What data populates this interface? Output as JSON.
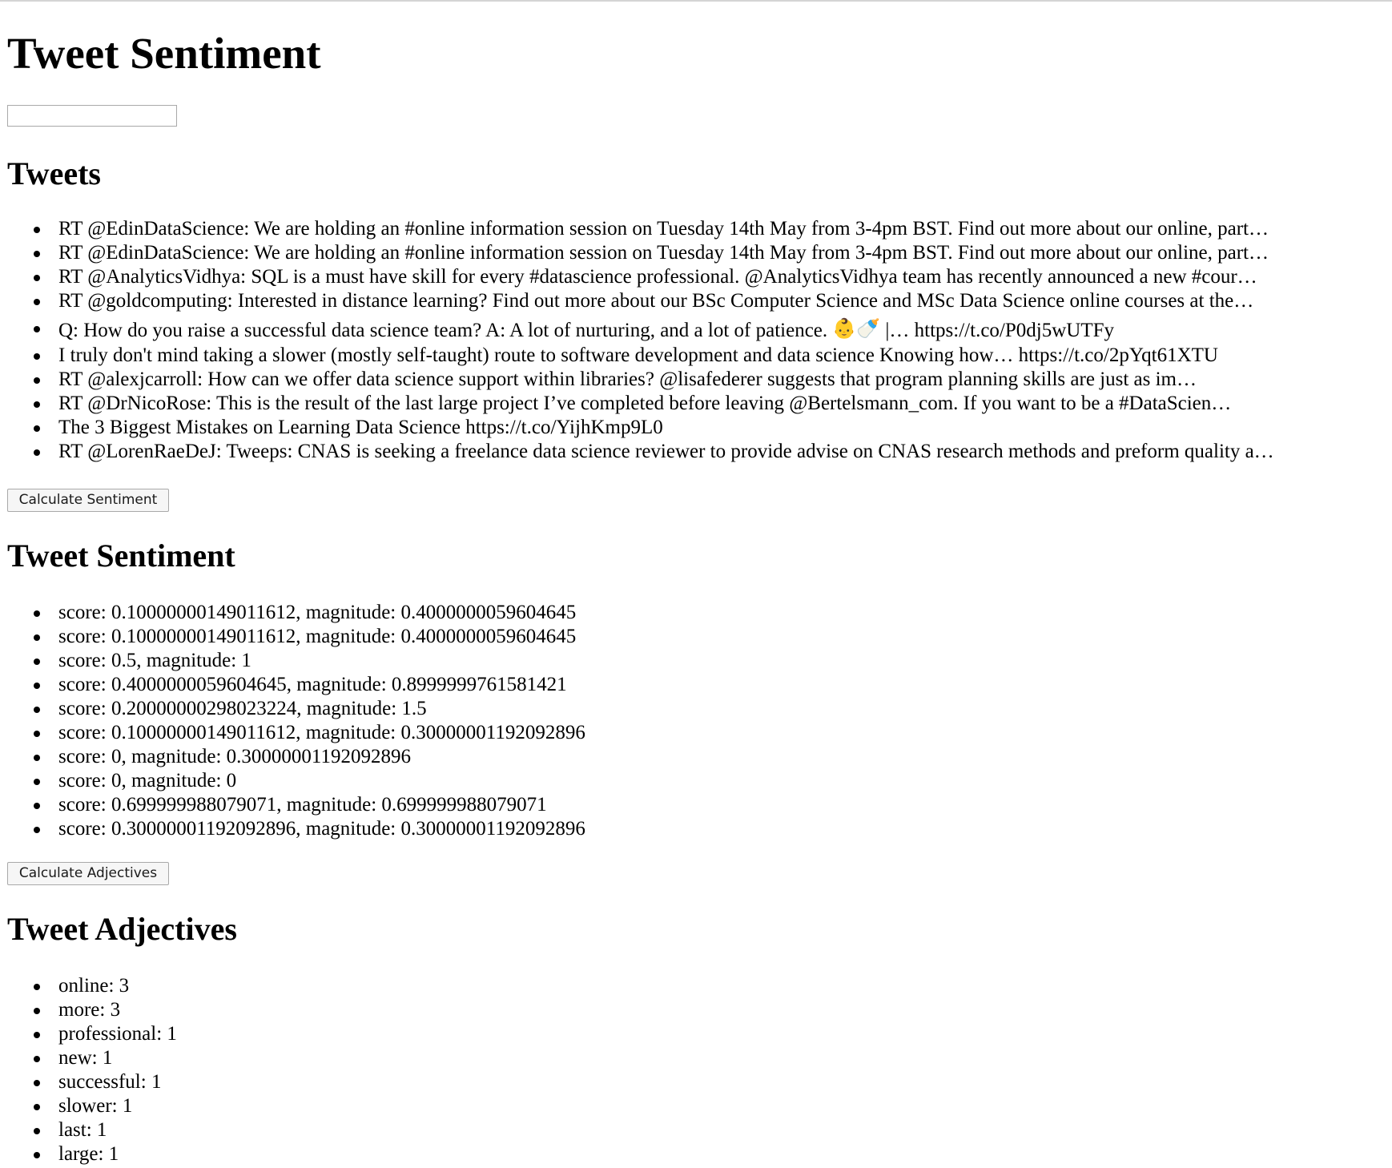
{
  "page": {
    "title": "Tweet Sentiment",
    "search": {
      "value": "",
      "placeholder": ""
    }
  },
  "tweets": {
    "heading": "Tweets",
    "items": [
      "RT @EdinDataScience: We are holding an #online information session on Tuesday 14th May from 3-4pm BST. Find out more about our online, part…",
      "RT @EdinDataScience: We are holding an #online information session on Tuesday 14th May from 3-4pm BST. Find out more about our online, part…",
      "RT @AnalyticsVidhya: SQL is a must have skill for every #datascience professional. @AnalyticsVidhya team has recently announced a new #cour…",
      "RT @goldcomputing: Interested in distance learning? Find out more about our BSc Computer Science and MSc Data Science online courses at the…",
      "Q: How do you raise a successful data science team? A: A lot of nurturing, and a lot of patience.",
      "I truly don't mind taking a slower (mostly self-taught) route to software development and data science Knowing how… https://t.co/2pYqt61XTU",
      "RT @alexjcarroll: How can we offer data science support within libraries? @lisafederer suggests that program planning skills are just as im…",
      "RT @DrNicoRose: This is the result of the last large project I’ve completed before leaving @Bertelsmann_com. If you want to be a #DataScien…",
      "The 3 Biggest Mistakes on Learning Data Science https://t.co/YijhKmp9L0",
      "RT @LorenRaeDeJ: Tweeps: CNAS is seeking a freelance data science reviewer to provide advise on CNAS research methods and preform quality a…"
    ],
    "item5_emoji": "👶🍼",
    "item5_suffix": " |… https://t.co/P0dj5wUTFy",
    "button_label": "Calculate Sentiment"
  },
  "sentiment": {
    "heading": "Tweet Sentiment",
    "items": [
      "score: 0.10000000149011612, magnitude: 0.4000000059604645",
      "score: 0.10000000149011612, magnitude: 0.4000000059604645",
      "score: 0.5, magnitude: 1",
      "score: 0.4000000059604645, magnitude: 0.8999999761581421",
      "score: 0.20000000298023224, magnitude: 1.5",
      "score: 0.10000000149011612, magnitude: 0.30000001192092896",
      "score: 0, magnitude: 0.30000001192092896",
      "score: 0, magnitude: 0",
      "score: 0.699999988079071, magnitude: 0.699999988079071",
      "score: 0.30000001192092896, magnitude: 0.30000001192092896"
    ],
    "button_label": "Calculate Adjectives"
  },
  "adjectives": {
    "heading": "Tweet Adjectives",
    "items": [
      "online: 3",
      "more: 3",
      "professional: 1",
      "new: 1",
      "successful: 1",
      "slower: 1",
      "last: 1",
      "large: 1"
    ]
  }
}
